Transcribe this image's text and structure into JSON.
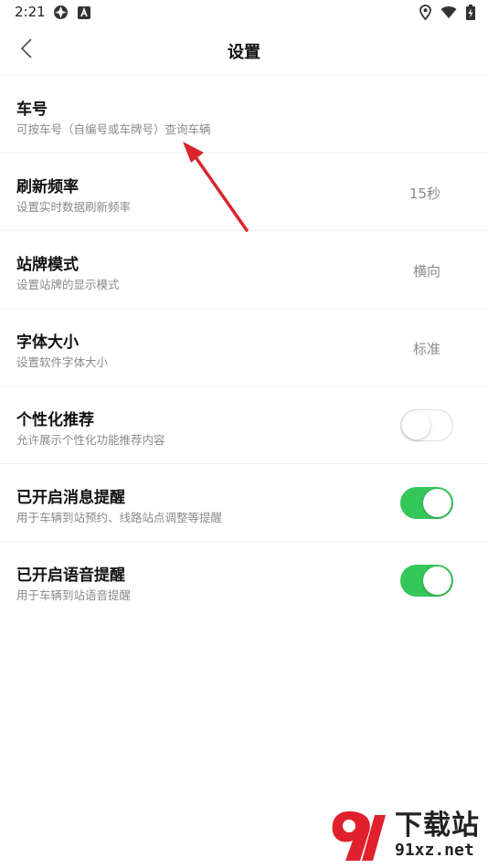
{
  "status_bar": {
    "time": "2:21",
    "icons": [
      "aperture-icon",
      "a-badge-icon",
      "location-icon",
      "wifi-icon",
      "battery-charging-icon"
    ]
  },
  "header": {
    "title": "设置",
    "back_icon": "chevron-left-icon"
  },
  "settings": [
    {
      "title": "车号",
      "subtitle": "可按车号（自编号或车牌号）查询车辆",
      "value": "",
      "control": "none"
    },
    {
      "title": "刷新频率",
      "subtitle": "设置实时数据刷新频率",
      "value": "15秒",
      "control": "value"
    },
    {
      "title": "站牌模式",
      "subtitle": "设置站牌的显示模式",
      "value": "横向",
      "control": "value"
    },
    {
      "title": "字体大小",
      "subtitle": "设置软件字体大小",
      "value": "标准",
      "control": "value"
    },
    {
      "title": "个性化推荐",
      "subtitle": "允许展示个性化功能推荐内容",
      "value": "",
      "control": "toggle",
      "toggle_on": false
    },
    {
      "title": "已开启消息提醒",
      "subtitle": "用于车辆到站预约、线路站点调整等提醒",
      "value": "",
      "control": "toggle",
      "toggle_on": true
    },
    {
      "title": "已开启语音提醒",
      "subtitle": "用于车辆到站语音提醒",
      "value": "",
      "control": "toggle",
      "toggle_on": true
    }
  ],
  "annotation": {
    "arrow_color": "#d9262c"
  },
  "watermark": {
    "brand": "下载站",
    "url": "91xz.net",
    "accent": "#e0202c"
  },
  "colors": {
    "toggle_on": "#35c759",
    "divider": "#efefef",
    "secondary_text": "#8a8a8a"
  }
}
